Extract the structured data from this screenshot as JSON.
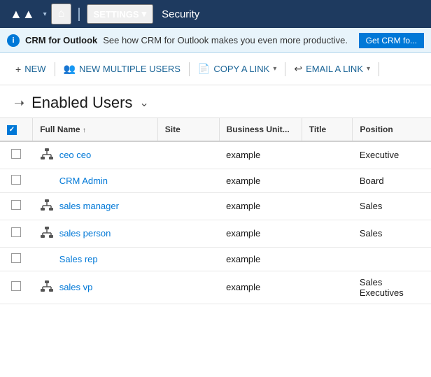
{
  "nav": {
    "logo": "▲▲",
    "chevron": "▾",
    "home_icon": "⌂",
    "divider": "|",
    "settings_label": "SETTINGS",
    "settings_arrow": "▾",
    "security_label": "Security"
  },
  "infobar": {
    "app_name": "CRM for Outlook",
    "message": "See how CRM for Outlook makes you even more productive.",
    "action_label": "Get CRM fo..."
  },
  "toolbar": {
    "new_label": "NEW",
    "new_multiple_label": "NEW MULTIPLE USERS",
    "copy_link_label": "COPY A LINK",
    "email_link_label": "EMAIL A LINK"
  },
  "page": {
    "title": "Enabled Users",
    "dropdown_arrow": "⌄"
  },
  "table": {
    "columns": [
      "",
      "Full Name",
      "Site",
      "Business Unit...",
      "Title",
      "Position"
    ],
    "rows": [
      {
        "has_icon": true,
        "name": "ceo ceo",
        "site": "",
        "business_unit": "example",
        "title": "",
        "position": "Executive"
      },
      {
        "has_icon": false,
        "name": "CRM Admin",
        "site": "",
        "business_unit": "example",
        "title": "",
        "position": "Board"
      },
      {
        "has_icon": true,
        "name": "sales manager",
        "site": "",
        "business_unit": "example",
        "title": "",
        "position": "Sales"
      },
      {
        "has_icon": true,
        "name": "sales person",
        "site": "",
        "business_unit": "example",
        "title": "",
        "position": "Sales"
      },
      {
        "has_icon": false,
        "name": "Sales rep",
        "site": "",
        "business_unit": "example",
        "title": "",
        "position": ""
      },
      {
        "has_icon": true,
        "name": "sales vp",
        "site": "",
        "business_unit": "example",
        "title": "",
        "position": "Sales Executives"
      }
    ]
  }
}
